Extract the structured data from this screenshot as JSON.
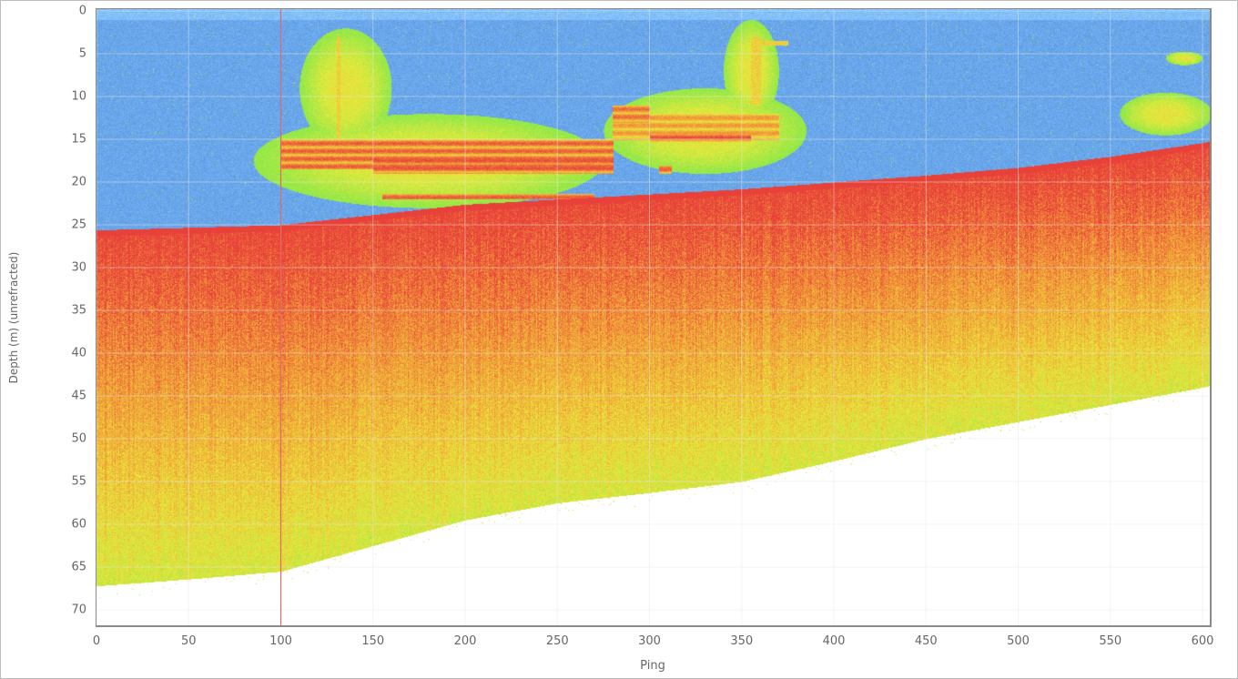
{
  "chart_data": {
    "type": "heatmap",
    "title": "",
    "xlabel": "Ping",
    "ylabel": "Depth (m) (unrefracted)",
    "xlim": [
      0,
      604
    ],
    "ylim": [
      72,
      0
    ],
    "x_ticks": [
      0,
      50,
      100,
      150,
      200,
      250,
      300,
      350,
      400,
      450,
      500,
      550,
      600
    ],
    "y_ticks": [
      0,
      5,
      10,
      15,
      20,
      25,
      30,
      35,
      40,
      45,
      50,
      55,
      60,
      65,
      70
    ],
    "grid": true,
    "marker_ping": 100,
    "seafloor_depth": {
      "ping": [
        0,
        100,
        150,
        200,
        250,
        300,
        350,
        400,
        450,
        500,
        550,
        600,
        604
      ],
      "depth": [
        25.6,
        25.0,
        23.8,
        22.6,
        22.0,
        21.4,
        20.8,
        20.0,
        19.2,
        18.3,
        17.0,
        15.4,
        15.2
      ]
    },
    "max_range_depth": {
      "ping": [
        0,
        50,
        100,
        150,
        200,
        250,
        300,
        350,
        400,
        450,
        500,
        550,
        600,
        604
      ],
      "depth": [
        67.2,
        66.4,
        65.5,
        62.5,
        59.5,
        57.5,
        56.3,
        55.0,
        52.6,
        50.0,
        48.0,
        46.0,
        44.0,
        43.8
      ]
    },
    "wreck": {
      "ping_range": [
        100,
        370
      ],
      "depth_range": [
        3,
        23
      ]
    },
    "colors": {
      "water": "#6aa6ea",
      "strong": "#e8413a",
      "mid": "#f2a23a",
      "weak": "#e9e93c",
      "faint": "#8de84a",
      "marker": "#e06a6a",
      "grid": "#e6e6e6"
    }
  }
}
